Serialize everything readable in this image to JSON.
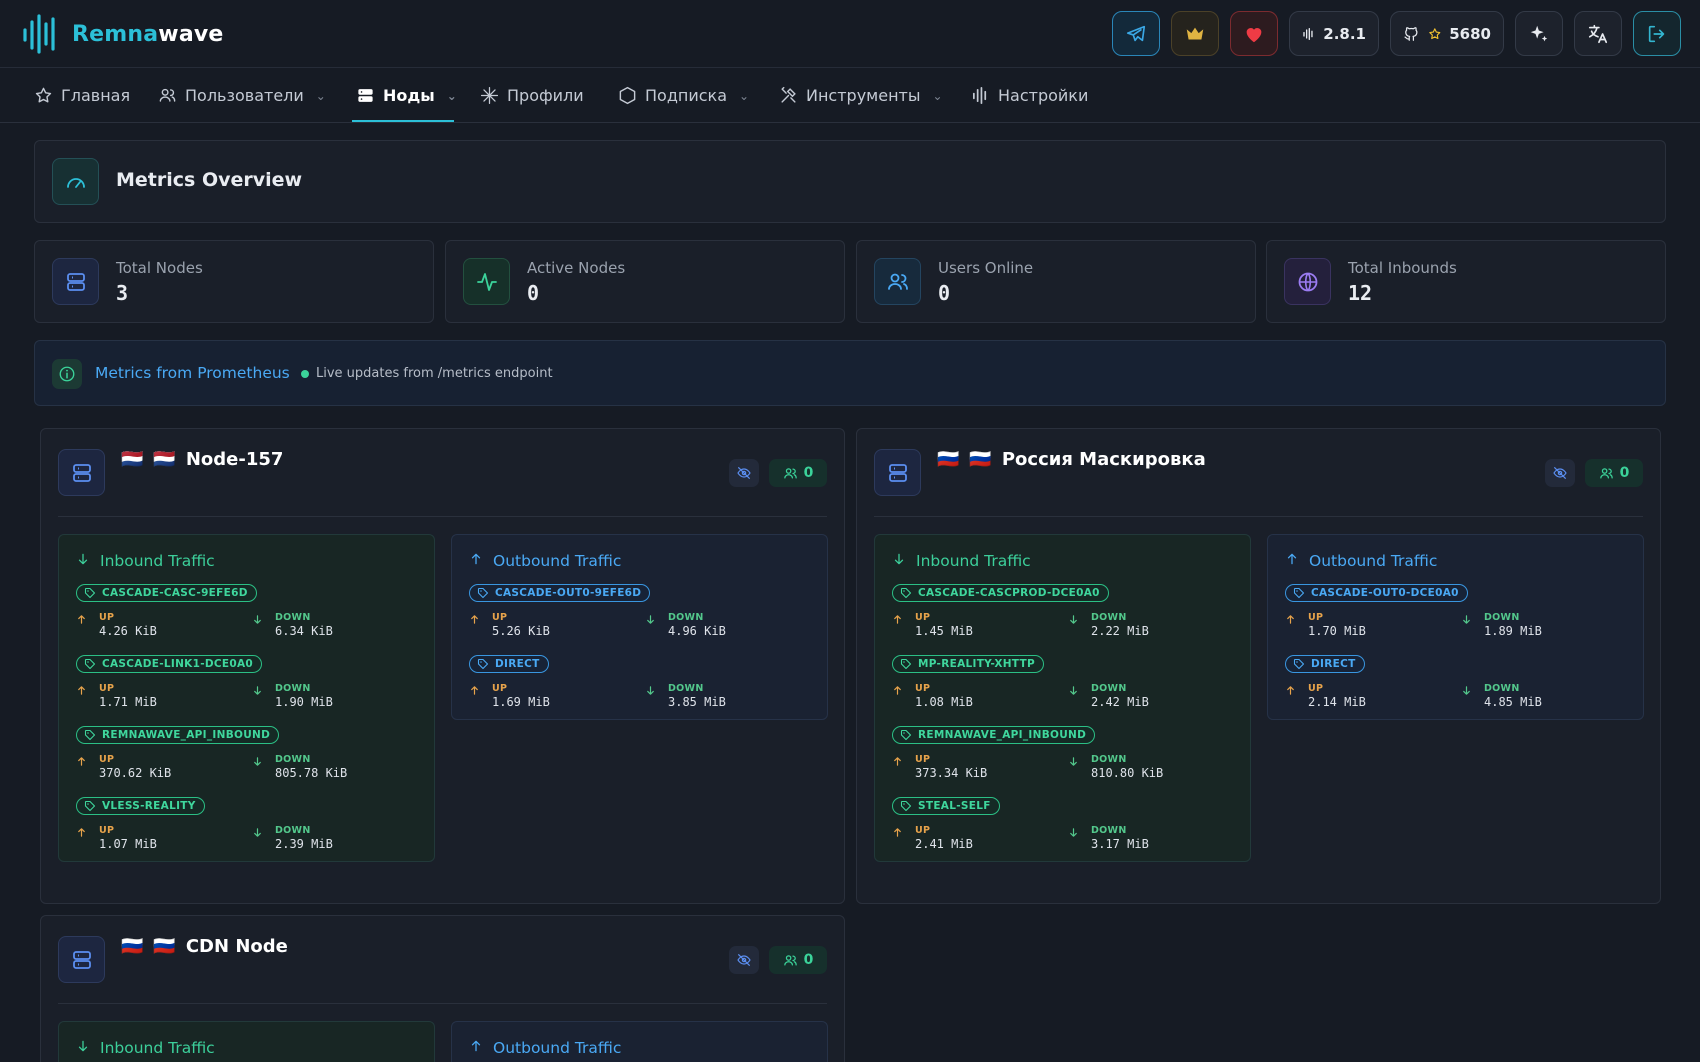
{
  "app": {
    "brand_part1": "Remna",
    "brand_part2": "wave"
  },
  "header": {
    "version": "2.8.1",
    "github_stars": "5680"
  },
  "nav": {
    "items": [
      {
        "label": "Главная"
      },
      {
        "label": "Пользователи"
      },
      {
        "label": "Ноды"
      },
      {
        "label": "Профили"
      },
      {
        "label": "Подписка"
      },
      {
        "label": "Инструменты"
      },
      {
        "label": "Настройки"
      }
    ]
  },
  "overview": {
    "title": "Metrics Overview"
  },
  "stats": [
    {
      "label": "Total Nodes",
      "value": "3"
    },
    {
      "label": "Active Nodes",
      "value": "0"
    },
    {
      "label": "Users Online",
      "value": "0"
    },
    {
      "label": "Total Inbounds",
      "value": "12"
    }
  ],
  "prometheus": {
    "title": "Metrics from Prometheus",
    "subtitle": "Live updates from /metrics endpoint"
  },
  "labels": {
    "inbound": "Inbound Traffic",
    "outbound": "Outbound Traffic",
    "up": "UP",
    "down": "DOWN"
  },
  "nodes": [
    {
      "name": "Node-157",
      "flags": [
        "🇳🇱",
        "🇳🇱"
      ],
      "users": "0",
      "inbound": [
        {
          "tag": "CASCADE-CASC-9EFE6D",
          "up": "4.26 KiB",
          "down": "6.34 KiB"
        },
        {
          "tag": "CASCADE-LINK1-DCE0A0",
          "up": "1.71 MiB",
          "down": "1.90 MiB"
        },
        {
          "tag": "REMNAWAVE_API_INBOUND",
          "up": "370.62 KiB",
          "down": "805.78 KiB"
        },
        {
          "tag": "VLESS-REALITY",
          "up": "1.07 MiB",
          "down": "2.39 MiB"
        }
      ],
      "outbound": [
        {
          "tag": "CASCADE-OUT0-9EFE6D",
          "up": "5.26 KiB",
          "down": "4.96 KiB"
        },
        {
          "tag": "DIRECT",
          "up": "1.69 MiB",
          "down": "3.85 MiB"
        }
      ]
    },
    {
      "name": "Россия Маскировка",
      "flags": [
        "🇷🇺",
        "🇷🇺"
      ],
      "users": "0",
      "inbound": [
        {
          "tag": "CASCADE-CASCPROD-DCE0A0",
          "up": "1.45 MiB",
          "down": "2.22 MiB"
        },
        {
          "tag": "MP-REALITY-XHTTP",
          "up": "1.08 MiB",
          "down": "2.42 MiB"
        },
        {
          "tag": "REMNAWAVE_API_INBOUND",
          "up": "373.34 KiB",
          "down": "810.80 KiB"
        },
        {
          "tag": "STEAL-SELF",
          "up": "2.41 MiB",
          "down": "3.17 MiB"
        }
      ],
      "outbound": [
        {
          "tag": "CASCADE-OUT0-DCE0A0",
          "up": "1.70 MiB",
          "down": "1.89 MiB"
        },
        {
          "tag": "DIRECT",
          "up": "2.14 MiB",
          "down": "4.85 MiB"
        }
      ]
    },
    {
      "name": "CDN Node",
      "flags": [
        "🇷🇺",
        "🇷🇺"
      ],
      "users": "0",
      "inbound": [],
      "outbound": []
    }
  ]
}
